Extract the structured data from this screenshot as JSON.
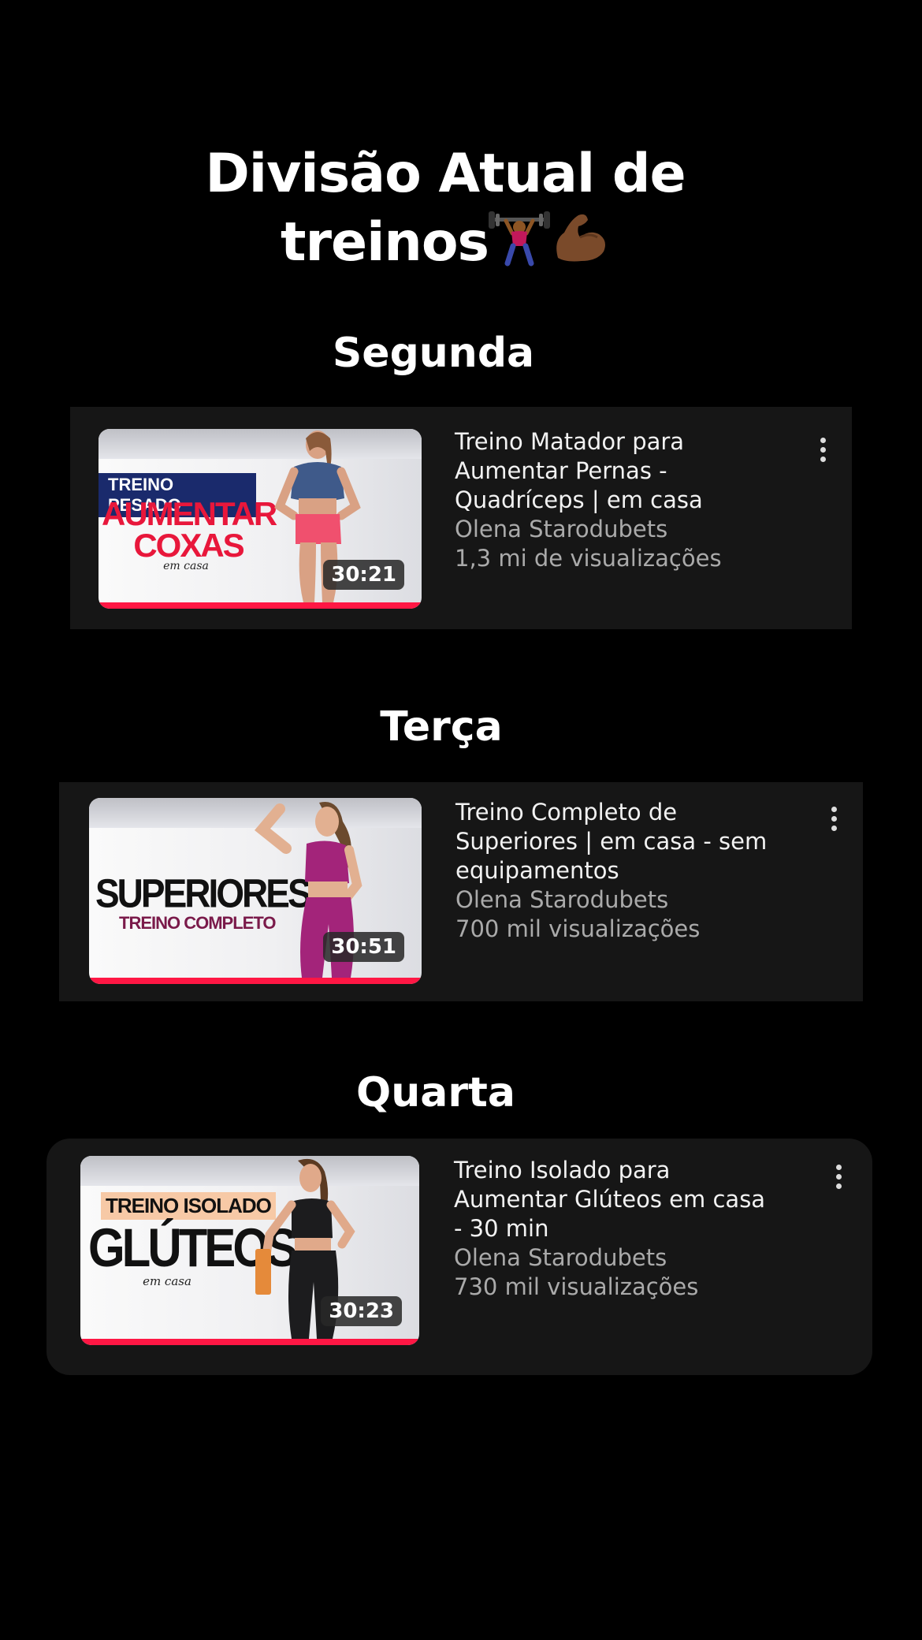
{
  "header": {
    "title_line1": "Divisão Atual de",
    "title_line2": "treinos"
  },
  "days": [
    {
      "label": "Segunda",
      "video": {
        "title_lines": [
          "Treino Matador para",
          "Aumentar Pernas -",
          "Quadríceps | em casa"
        ],
        "channel": "Olena Starodubets",
        "views": "1,3 mi de visualizações",
        "duration": "30:21",
        "thumb_tag": "TREINO PESADO",
        "thumb_big1": "AUMENTAR",
        "thumb_big2": "COXAS",
        "thumb_small": "em casa"
      }
    },
    {
      "label": "Terça",
      "video": {
        "title_lines": [
          "Treino Completo de",
          "Superiores | em casa - sem",
          "equipamentos"
        ],
        "channel": "Olena Starodubets",
        "views": "700 mil visualizações",
        "duration": "30:51",
        "thumb_big1": "SUPERIORES",
        "thumb_sub": "TREINO COMPLETO"
      }
    },
    {
      "label": "Quarta",
      "video": {
        "title_lines": [
          "Treino Isolado para",
          "Aumentar Glúteos em casa",
          "- 30 min"
        ],
        "channel": "Olena Starodubets",
        "views": "730 mil visualizações",
        "duration": "30:23",
        "thumb_tag": "TREINO ISOLADO",
        "thumb_big1": "GLÚTEOS",
        "thumb_small": "em casa"
      }
    }
  ],
  "icons": [
    "weightlifter-emoji-icon",
    "flexed-biceps-emoji-icon",
    "more-vertical-icon"
  ],
  "colors": {
    "background": "#000000",
    "card": "#161616",
    "progress": "#ff1744",
    "thumb_red": "#e8173b",
    "thumb_navy": "#1a2a6c"
  }
}
